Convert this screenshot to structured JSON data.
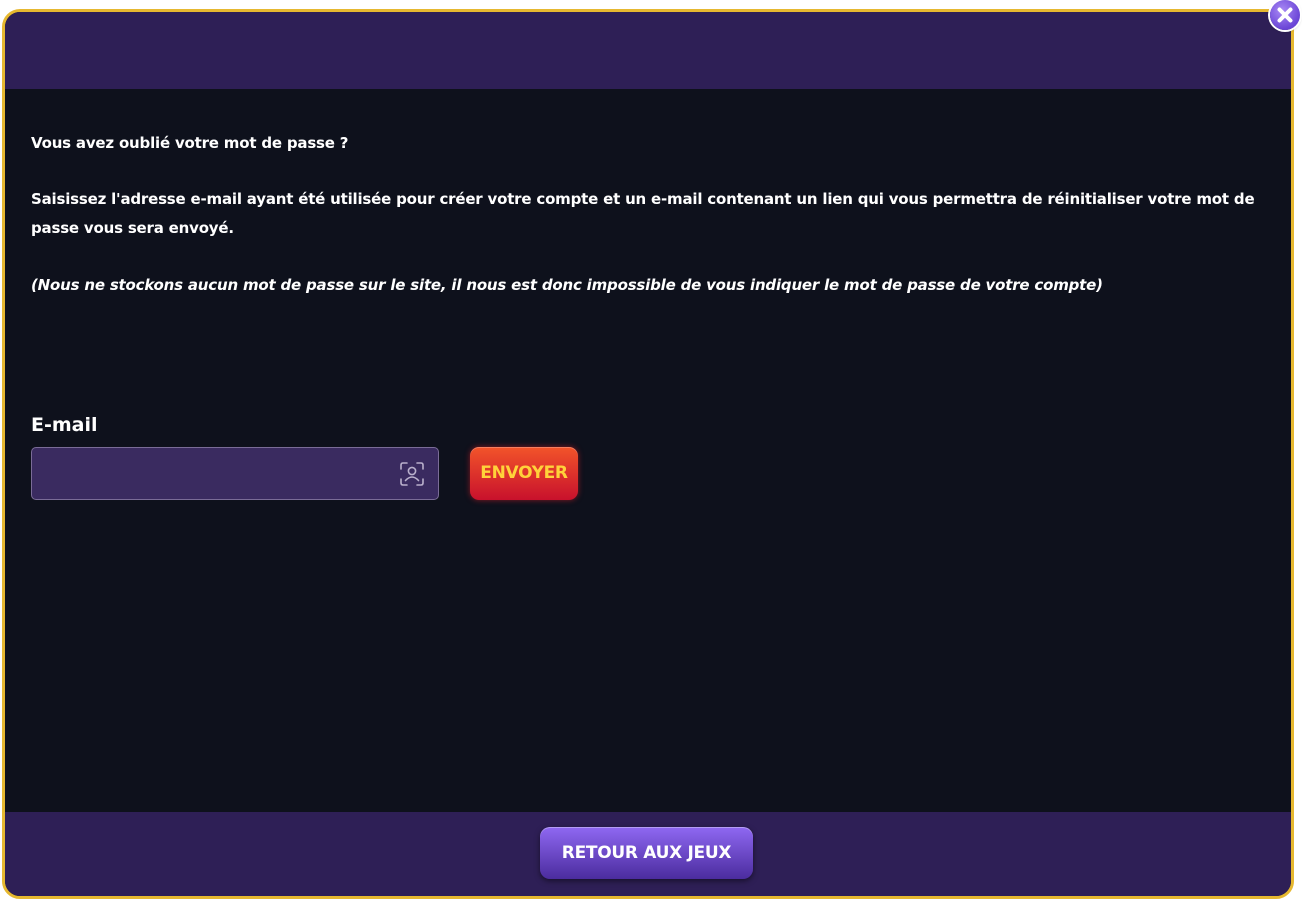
{
  "modal": {
    "text": {
      "title": "Vous avez oublié votre mot de passe ?",
      "instructions": "Saisissez l'adresse e-mail ayant été utilisée pour créer votre compte et un e-mail contenant un lien qui vous permettra de réinitialiser votre mot de passe vous sera envoyé.",
      "note": "(Nous ne stockons aucun mot de passe sur le site, il nous est donc impossible de vous indiquer le mot de passe de votre compte)"
    },
    "form": {
      "email_label": "E-mail",
      "email_value": "",
      "email_placeholder": "",
      "send_label": "ENVOYER"
    },
    "footer": {
      "back_label": "RETOUR AUX JEUX"
    }
  },
  "icons": {
    "close": "close-icon",
    "contact": "contact-scan-icon"
  },
  "colors": {
    "header_footer": "#2e1f56",
    "body": "#0e111c",
    "border": "#e6b830",
    "input_bg": "#3a2b60",
    "send_button": "#d9232c",
    "send_text": "#ffd23a",
    "back_button": "#6b48d4"
  }
}
